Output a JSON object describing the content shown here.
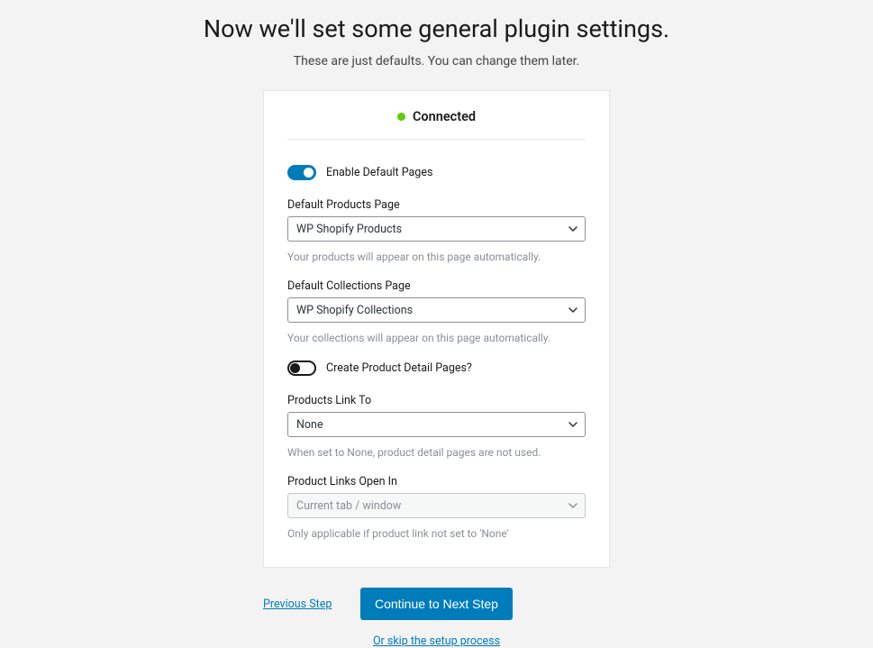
{
  "header": {
    "title": "Now we'll set some general plugin settings.",
    "subtitle": "These are just defaults. You can change them later."
  },
  "status": {
    "label": "Connected"
  },
  "settings": {
    "enable_pages": {
      "label": "Enable Default Pages",
      "on": true
    },
    "products_page": {
      "label": "Default Products Page",
      "value": "WP Shopify Products",
      "help": "Your products will appear on this page automatically."
    },
    "collections_page": {
      "label": "Default Collections Page",
      "value": "WP Shopify Collections",
      "help": "Your collections will appear on this page automatically."
    },
    "create_detail": {
      "label": "Create Product Detail Pages?",
      "on": false
    },
    "products_link_to": {
      "label": "Products Link To",
      "value": "None",
      "help": "When set to None, product detail pages are not used."
    },
    "links_open_in": {
      "label": "Product Links Open In",
      "value": "Current tab / window",
      "help": "Only applicable if product link not set to 'None'",
      "disabled": true
    }
  },
  "footer": {
    "previous": "Previous Step",
    "next": "Continue to Next Step",
    "skip": "Or skip the setup process"
  }
}
